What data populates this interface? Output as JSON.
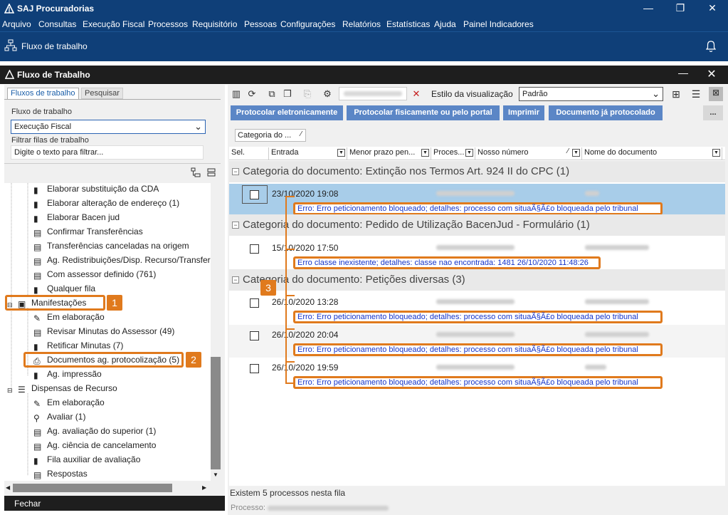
{
  "window": {
    "title": "SAJ Procuradorias"
  },
  "menu": [
    "Arquivo",
    "Consultas",
    "Execução Fiscal",
    "Processos",
    "Requisitório",
    "Pessoas",
    "Configurações",
    "Relatórios",
    "Estatísticas",
    "Ajuda",
    "Painel Indicadores"
  ],
  "nav": {
    "label": "Fluxo de trabalho"
  },
  "inner": {
    "title": "Fluxo de Trabalho"
  },
  "left": {
    "tabs": [
      "Fluxos de trabalho",
      "Pesquisar"
    ],
    "flow_label": "Fluxo de trabalho",
    "flow_value": "Execução Fiscal",
    "filter_label": "Filtrar filas de trabalho",
    "filter_value": "Digite o texto para filtrar...",
    "tree": [
      "Elaborar substituição da CDA",
      "Elaborar alteração de endereço (1)",
      "Elaborar Bacen jud",
      "Confirmar Transferências",
      "Transferências canceladas na origem",
      "Ag. Redistribuições/Disp. Recurso/Transfer",
      "Com assessor definido (761)",
      "Qualquer fila",
      "Manifestações",
      "Em elaboração",
      "Revisar Minutas do Assessor (49)",
      "Retificar Minutas (7)",
      "Documentos ag. protocolização (5)",
      "Ag. impressão",
      "Dispensas de Recurso",
      "Em elaboração",
      "Avaliar (1)",
      "Ag. avaliação do superior (1)",
      "Ag. ciência de cancelamento",
      "Fila auxiliar de avaliação",
      "Respostas"
    ],
    "close": "Fechar"
  },
  "toolbar": {
    "style_label": "Estilo da visualização",
    "style_value": "Padrão"
  },
  "buttons": [
    "Protocolar eletronicamente",
    "Protocolar fisicamente ou pelo portal",
    "Imprimir",
    "Documento já protocolado",
    "..."
  ],
  "grid": {
    "groupby_chip": "Categoria do ...",
    "columns": [
      "Sel.",
      "Entrada",
      "Menor prazo pen...",
      "Proces...",
      "Nosso número",
      "Nome do documento"
    ],
    "groups": [
      {
        "title": "Categoria do documento: Extinção nos Termos Art. 924 II do CPC  (1)",
        "rows": [
          {
            "date": "23/10/2020 19:08",
            "error": "Erro: Erro peticionamento bloqueado; detalhes: processo com situaÃ§Ã£o bloqueada pelo tribunal",
            "selected": true
          }
        ]
      },
      {
        "title": "Categoria do documento: Pedido de Utilização BacenJud - Formulário  (1)",
        "rows": [
          {
            "date": "15/10/2020 17:50",
            "error": "Erro classe inexistente; detalhes: classe nao encontrada: 1481 26/10/2020 11:48:26",
            "selected": false
          }
        ]
      },
      {
        "title": "Categoria do documento: Petições diversas  (3)",
        "rows": [
          {
            "date": "26/10/2020 13:28",
            "error": "Erro: Erro peticionamento bloqueado; detalhes: processo com situaÃ§Ã£o bloqueada pelo tribunal",
            "selected": false
          },
          {
            "date": "26/10/2020 20:04",
            "error": "Erro: Erro peticionamento bloqueado; detalhes: processo com situaÃ§Ã£o bloqueada pelo tribunal",
            "selected": false
          },
          {
            "date": "26/10/2020 19:59",
            "error": "Erro: Erro peticionamento bloqueado; detalhes: processo com situaÃ§Ã£o bloqueada pelo tribunal",
            "selected": false
          }
        ]
      }
    ]
  },
  "status": {
    "count": "Existem 5 processos nesta fila",
    "process_label": "Processo:"
  },
  "callouts": [
    "1",
    "2",
    "3"
  ],
  "accent_color": "#e07a1d"
}
